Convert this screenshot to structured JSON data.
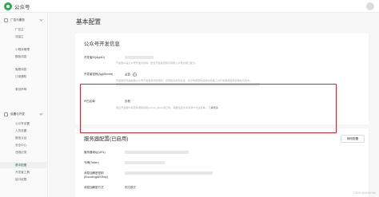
{
  "app": {
    "title": "公众号"
  },
  "sidebar": {
    "groups": [
      {
        "label": "广告与服务",
        "items": [
          "广告主",
          "流量主",
          "",
          "小程序管理",
          "模板消息",
          "",
          "客服消息",
          "订阅通知",
          "",
          "原创声明"
        ]
      },
      {
        "label": "设置与开发",
        "items": [
          "公众号设置",
          "人员设置",
          "微信认证",
          "安全中心",
          "违规记录",
          "",
          "基本配置",
          "开发者工具",
          "接口权限"
        ]
      }
    ],
    "active_item": "基本配置"
  },
  "main": {
    "page_title": "基本配置",
    "dev_panel": {
      "title": "公众号开发信息",
      "rows": [
        {
          "label": "开发者ID(AppID)",
          "value": "",
          "desc": "开发者ID是公众号开发识别码，配合开发者密码可调用公众号的接口能力。"
        },
        {
          "label": "开发者密码(AppSecret)",
          "value": "重置",
          "desc": "开发者密码是校验公众号开发者身份的密码，具有极高的安全性。切记勿把密码直接交给第三方开发者或直接存储在代码中。"
        },
        {
          "label": "IP白名单",
          "value": "查看",
          "desc": "通过开发者ID及密码调用获取access_token接口时，需要设置访问来源IP为白名单。",
          "link": "了解更多"
        }
      ]
    },
    "server_panel": {
      "title": "服务器配置(已启用)",
      "button": "修改配置",
      "rows": [
        {
          "label": "服务器地址(URL)",
          "value": ""
        },
        {
          "label": "令牌(Token)",
          "value": ""
        },
        {
          "label": "消息加解密密钥(EncodingAESKey)",
          "value": ""
        },
        {
          "label": "消息加解密方式",
          "value": "明文模式"
        }
      ]
    }
  },
  "watermark": "CSDN @Abbie.Mu"
}
